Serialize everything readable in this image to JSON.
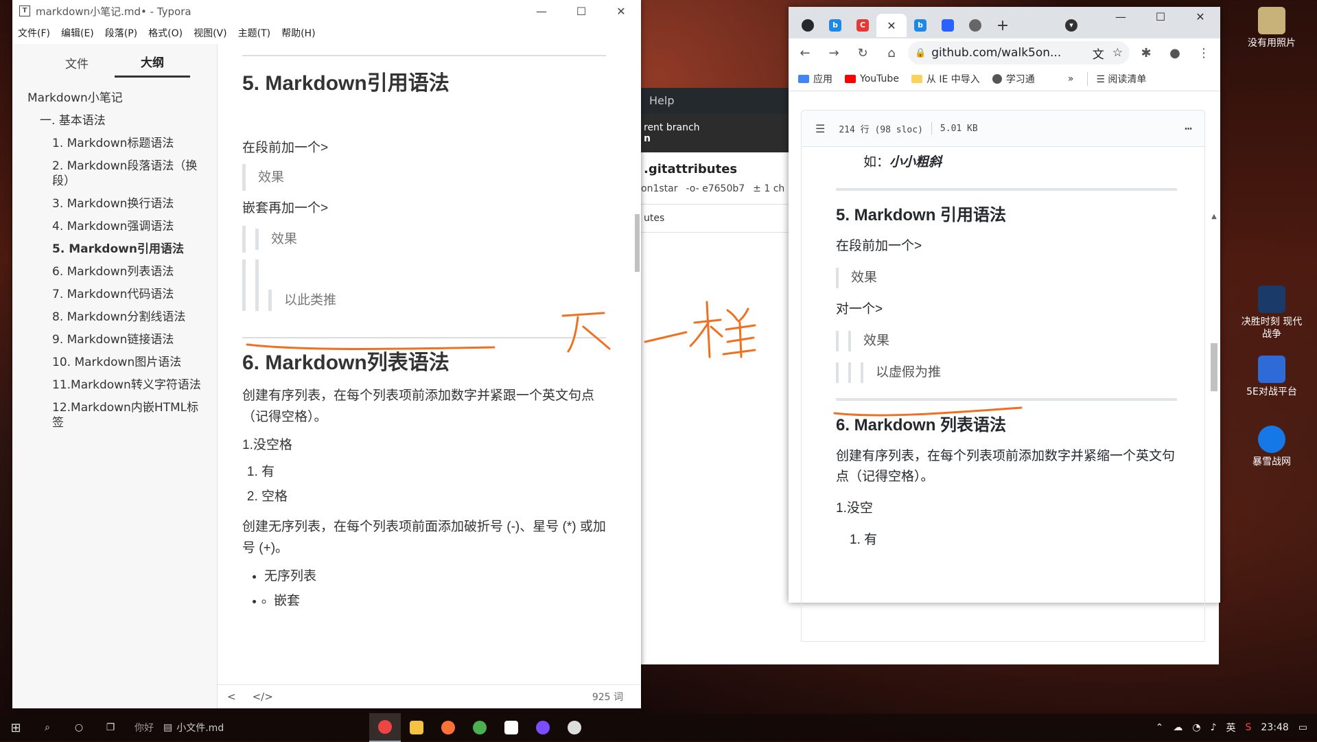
{
  "typora": {
    "title": "markdown小笔记.md• - Typora",
    "app_icon": "T",
    "controls": {
      "minimize": "—",
      "maximize": "☐",
      "close": "✕"
    },
    "menu": [
      "文件(F)",
      "编辑(E)",
      "段落(P)",
      "格式(O)",
      "视图(V)",
      "主题(T)",
      "帮助(H)"
    ],
    "sidebar": {
      "tabs": [
        {
          "label": "文件",
          "active": false
        },
        {
          "label": "大纲",
          "active": true
        }
      ],
      "outline": [
        {
          "label": "Markdown小笔记",
          "level": 1
        },
        {
          "label": "一. 基本语法",
          "level": 2
        },
        {
          "label": "1. Markdown标题语法",
          "level": 3
        },
        {
          "label": "2. Markdown段落语法（换段）",
          "level": 3
        },
        {
          "label": "3. Markdown换行语法",
          "level": 3
        },
        {
          "label": "4. Markdown强调语法",
          "level": 3
        },
        {
          "label": "5. Markdown引用语法",
          "level": 3,
          "active": true
        },
        {
          "label": "6. Markdown列表语法",
          "level": 3
        },
        {
          "label": "7. Markdown代码语法",
          "level": 3
        },
        {
          "label": "8. Markdown分割线语法",
          "level": 3
        },
        {
          "label": "9. Markdown链接语法",
          "level": 3
        },
        {
          "label": "10. Markdown图片语法",
          "level": 3
        },
        {
          "label": "11.Markdown转义字符语法",
          "level": 3
        },
        {
          "label": "12.Markdown内嵌HTML标签",
          "level": 3
        }
      ]
    },
    "editor": {
      "h_quote": "5. Markdown引用语法",
      "p1": "在段前加一个>",
      "bq1": "效果",
      "p2": "嵌套再加一个>",
      "bq2": "效果",
      "bq3": "以此类推",
      "h_list": "6. Markdown列表语法",
      "p3": "创建有序列表，在每个列表项前添加数字并紧跟一个英文句点（记得空格）。",
      "p4": "1.没空格",
      "ol": [
        "有",
        "空格"
      ],
      "p5": "创建无序列表，在每个列表项前面添加破折号 (-)、星号 (*) 或加号 (+)。",
      "ul1": "无序列表",
      "ul2": "嵌套"
    },
    "status": {
      "back": "<",
      "source": "</>",
      "word_count": "925 词"
    }
  },
  "github_bg": {
    "menu_help": "Help",
    "branch_label": "rent branch",
    "branch_name": "n",
    "file_name": ".gitattributes",
    "author": "on1star",
    "commit": "e7650b7",
    "changes": "1 ch",
    "row_text": "utes"
  },
  "chrome": {
    "tabs": [
      {
        "icon": "github-icon",
        "color": "#24292e",
        "char": "●"
      },
      {
        "icon": "bing-icon",
        "color": "#1e88e5",
        "char": "b"
      },
      {
        "icon": "csdn-icon",
        "color": "#e53935",
        "char": "C"
      },
      {
        "icon": "close-icon",
        "color": "#333333",
        "char": "✕",
        "active": true
      },
      {
        "icon": "bing-icon",
        "color": "#1e88e5",
        "char": "b"
      },
      {
        "icon": "baidu-icon",
        "color": "#2962ff",
        "char": "百"
      },
      {
        "icon": "globe-icon",
        "color": "#555555",
        "char": "◉"
      },
      {
        "icon": "new-tab-icon",
        "color": "#333333",
        "char": "+"
      }
    ],
    "window_controls": {
      "minimize": "—",
      "maximize": "☐",
      "close": "✕"
    },
    "url": "github.com/walk5on...",
    "bookmarks": [
      "应用",
      "YouTube",
      "从 IE 中导入",
      "学习通"
    ],
    "reading_list": "阅读清单",
    "file_header": {
      "lines": "214 行 (98 sloc)",
      "size": "5.01 KB"
    },
    "md": {
      "example_prefix": "如：",
      "example_text": "小小粗斜",
      "h_quote": "5. Markdown 引用语法",
      "p1": "在段前加一个>",
      "bq1": "效果",
      "p2": "对一个>",
      "bq2": "效果",
      "bq3": "以虚假为推",
      "h_list": "6. Markdown 列表语法",
      "p3": "创建有序列表，在每个列表项前添加数字并紧缩一个英文句点（记得空格）。",
      "p4": "1.没空",
      "li1": "1. 有"
    }
  },
  "desktop": {
    "icons": [
      {
        "label": "没有用照片",
        "color": "#c9b27a"
      },
      {
        "label": "决胜时刻 现代战争",
        "color": "#1a3a6a"
      },
      {
        "label": "5E对战平台",
        "color": "#2e6bd6"
      },
      {
        "label": "暴雪战网",
        "color": "#1677e6"
      }
    ],
    "annotation": "不一样"
  },
  "taskbar": {
    "task_label": "小文件.md",
    "task_prefix": "你好",
    "tray_lang": "英",
    "time": "23:48"
  }
}
